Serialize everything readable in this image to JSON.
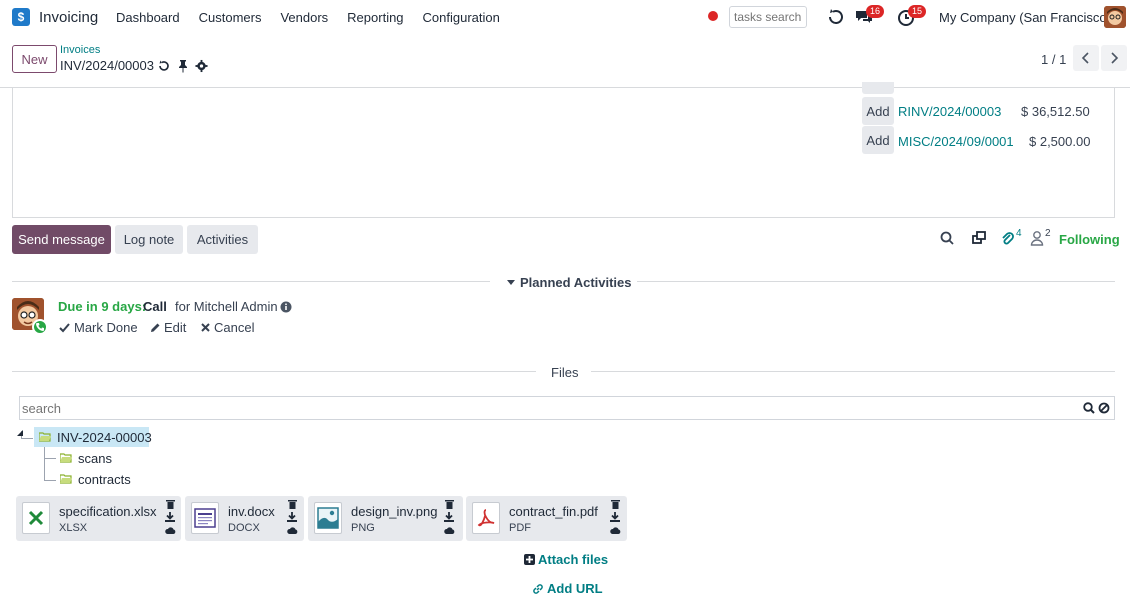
{
  "navbar": {
    "app_name": "Invoicing",
    "menu": [
      "Dashboard",
      "Customers",
      "Vendors",
      "Reporting",
      "Configuration"
    ],
    "tasks_search_placeholder": "tasks search",
    "messages_count": "16",
    "activities_count": "15",
    "company": "My Company (San Francisco)"
  },
  "control": {
    "new_label": "New",
    "breadcrumb": "Invoices",
    "record": "INV/2024/00003",
    "pager": "1 / 1"
  },
  "payments": [
    {
      "action": "Add",
      "ref": "RINV/2024/00003",
      "amount": "$ 36,512.50"
    },
    {
      "action": "Add",
      "ref": "MISC/2024/09/0001",
      "amount": "$ 2,500.00"
    }
  ],
  "chatter": {
    "send_message": "Send message",
    "log_note": "Log note",
    "activities": "Activities",
    "attachments_count": "4",
    "followers_count": "2",
    "following": "Following"
  },
  "planned": {
    "title": "Planned Activities",
    "due": "Due in 9 days:",
    "type": "Call",
    "for": "for Mitchell Admin",
    "mark_done": "Mark Done",
    "edit": "Edit",
    "cancel": "Cancel"
  },
  "files": {
    "title": "Files",
    "search_placeholder": "search",
    "root": "INV-2024-00003",
    "folders": [
      "scans",
      "contracts"
    ],
    "items": [
      {
        "name": "specification.xlsx",
        "ext": "XLSX",
        "kind": "excel-icon"
      },
      {
        "name": "inv.docx",
        "ext": "DOCX",
        "kind": "document-icon"
      },
      {
        "name": "design_inv.png",
        "ext": "PNG",
        "kind": "image-icon"
      },
      {
        "name": "contract_fin.pdf",
        "ext": "PDF",
        "kind": "pdf-icon"
      }
    ],
    "attach_files": "Attach files",
    "add_url": "Add URL"
  },
  "colors": {
    "brand": "#714b67",
    "link": "#017e84",
    "success": "#28a745",
    "danger": "#dc2626"
  }
}
